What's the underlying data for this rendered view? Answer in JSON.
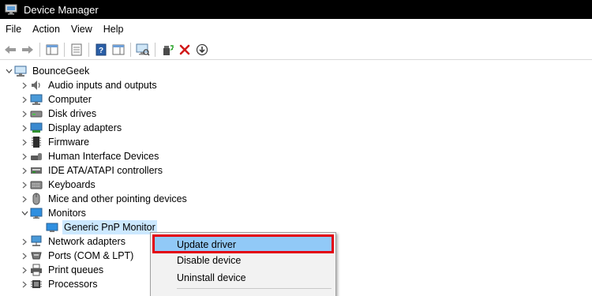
{
  "window": {
    "title": "Device Manager"
  },
  "menu": {
    "items": [
      "File",
      "Action",
      "View",
      "Help"
    ]
  },
  "toolbar": {
    "buttons": [
      "back-icon",
      "forward-icon",
      "show-hide-console-tree-icon",
      "properties-icon",
      "help-icon",
      "action-pane-icon",
      "scan-hardware-icon",
      "update-driver-icon",
      "uninstall-icon",
      "disable-icon"
    ]
  },
  "tree": {
    "root": "BounceGeek",
    "items": [
      {
        "label": "Audio inputs and outputs",
        "icon": "speaker-icon"
      },
      {
        "label": "Computer",
        "icon": "computer-icon"
      },
      {
        "label": "Disk drives",
        "icon": "disk-icon"
      },
      {
        "label": "Display adapters",
        "icon": "display-adapter-icon"
      },
      {
        "label": "Firmware",
        "icon": "firmware-icon"
      },
      {
        "label": "Human Interface Devices",
        "icon": "hid-icon"
      },
      {
        "label": "IDE ATA/ATAPI controllers",
        "icon": "ide-icon"
      },
      {
        "label": "Keyboards",
        "icon": "keyboard-icon"
      },
      {
        "label": "Mice and other pointing devices",
        "icon": "mouse-icon"
      },
      {
        "label": "Monitors",
        "icon": "monitor-icon",
        "expanded": true
      },
      {
        "label": "Generic PnP Monitor",
        "icon": "monitor-icon",
        "child": true,
        "selected": true
      },
      {
        "label": "Network adapters",
        "icon": "network-icon"
      },
      {
        "label": "Ports (COM & LPT)",
        "icon": "port-icon"
      },
      {
        "label": "Print queues",
        "icon": "printer-icon"
      },
      {
        "label": "Processors",
        "icon": "processor-icon"
      }
    ]
  },
  "context_menu": {
    "items": [
      "Update driver",
      "Disable device",
      "Uninstall device"
    ],
    "highlighted": "Update driver"
  },
  "colors": {
    "selection": "#cce8ff",
    "menu_highlight": "#91c9f7",
    "callout_border": "#e3000f"
  }
}
